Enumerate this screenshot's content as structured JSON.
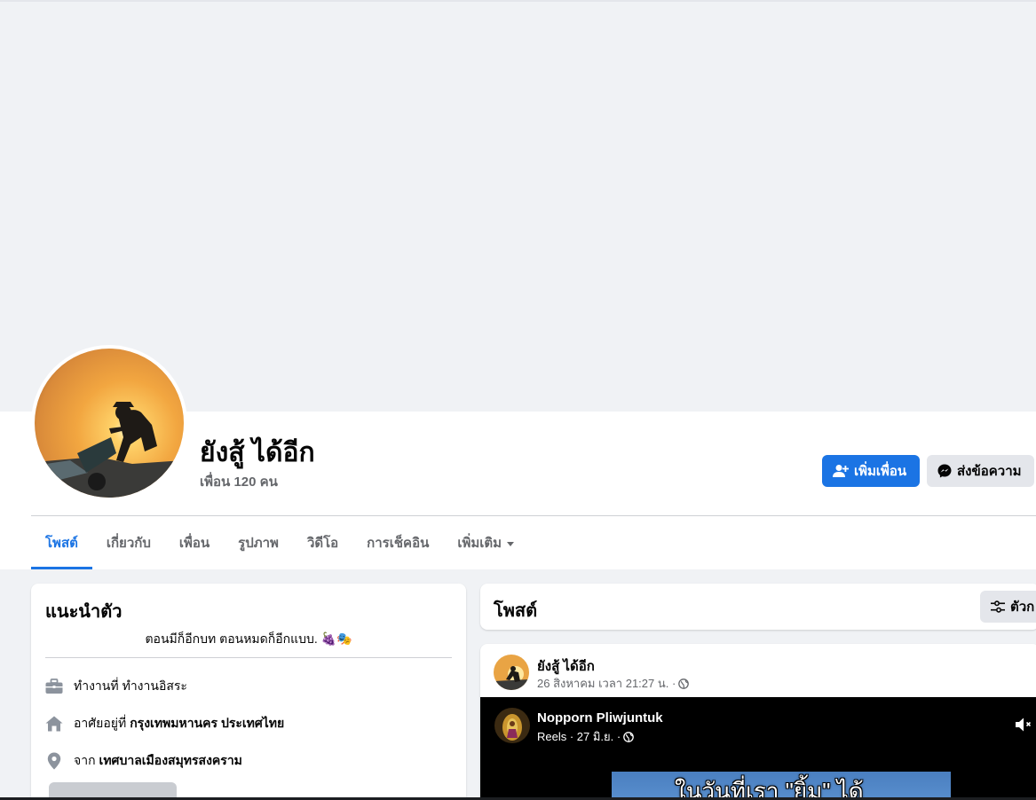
{
  "profile": {
    "name": "ยังสู้ ได้อีก",
    "friend_count": "เพื่อน 120 คน",
    "add_friend_label": "เพิ่มเพื่อน",
    "message_label": "ส่งข้อความ"
  },
  "tabs": [
    {
      "label": "โพสต์",
      "active": true
    },
    {
      "label": "เกี่ยวกับ"
    },
    {
      "label": "เพื่อน"
    },
    {
      "label": "รูปภาพ"
    },
    {
      "label": "วิดีโอ"
    },
    {
      "label": "การเช็คอิน"
    },
    {
      "label": "เพิ่มเติม"
    }
  ],
  "intro": {
    "title": "แนะนำตัว",
    "bio": "ตอนมีก็อีกบท ตอนหมดก็อีกแบบ. 🍇🎭",
    "work_prefix": "ทำงานที่",
    "work_value": "ทำงานอิสระ",
    "live_prefix": "อาศัยอยู่ที่",
    "live_value": "กรุงเทพมหานคร ประเทศไทย",
    "from_prefix": "จาก",
    "from_value": "เทศบาลเมืองสมุทรสงคราม"
  },
  "posts": {
    "title": "โพสต์",
    "filter_label": "ตัวก"
  },
  "post": {
    "author": "ยังสู้ ได้อีก",
    "timestamp": "26 สิงหาคม เวลา 21:27 น. ·",
    "shared": {
      "author": "Nopporn Pliwjuntuk",
      "meta": "Reels · 27 มิ.ย. ·",
      "caption": "ในวันที่เรา \"ยิ้ม\" ได้"
    }
  },
  "colors": {
    "accent": "#1b74e4",
    "page_bg": "#f0f2f5",
    "secondary_text": "#65676b"
  },
  "icons": {
    "add_friend": "person-plus-icon",
    "message": "messenger-icon",
    "work": "briefcase-icon",
    "live": "house-icon",
    "from": "location-pin-icon",
    "filter": "sliders-icon",
    "privacy": "globe-icon",
    "mute": "speaker-muted-icon"
  }
}
